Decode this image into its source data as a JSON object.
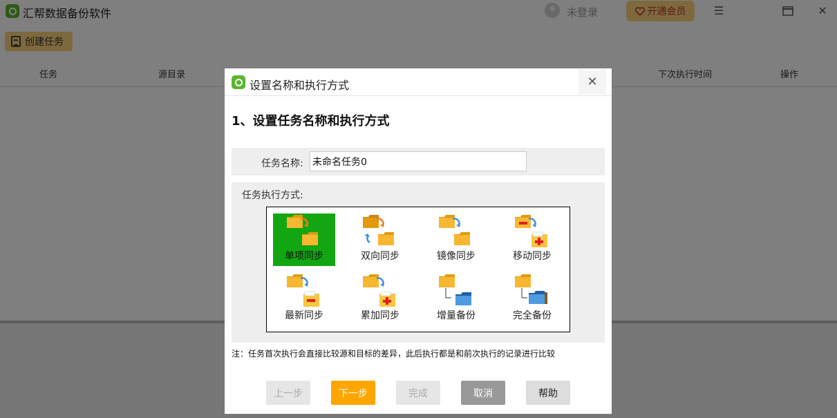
{
  "app": {
    "title": "汇帮数据备份软件",
    "login_status": "未登录",
    "vip_button": "开通会员",
    "create_task": "创建任务",
    "columns": [
      "任务",
      "源目录",
      "下次执行时间",
      "操作"
    ]
  },
  "dialog": {
    "title": "设置名称和执行方式",
    "heading": "1、设置任务名称和执行方式",
    "task_name_label": "任务名称:",
    "task_name_value": "未命名任务0",
    "mode_label": "任务执行方式:",
    "modes": [
      {
        "label": "单项同步",
        "selected": true
      },
      {
        "label": "双向同步",
        "selected": false
      },
      {
        "label": "镜像同步",
        "selected": false
      },
      {
        "label": "移动同步",
        "selected": false
      },
      {
        "label": "最新同步",
        "selected": false
      },
      {
        "label": "累加同步",
        "selected": false
      },
      {
        "label": "增量备份",
        "selected": false
      },
      {
        "label": "完全备份",
        "selected": false
      }
    ],
    "note": "注：任务首次执行会直接比较源和目标的差异，此后执行都是和前次执行的记录进行比较",
    "buttons": {
      "prev": "上一步",
      "next": "下一步",
      "done": "完成",
      "cancel": "取消",
      "help": "帮助"
    }
  },
  "colors": {
    "accent_orange": "#ffa500",
    "selected_green": "#12a712",
    "vip_gold": "#fbd27a",
    "folder_yellow": "#f7b731"
  }
}
